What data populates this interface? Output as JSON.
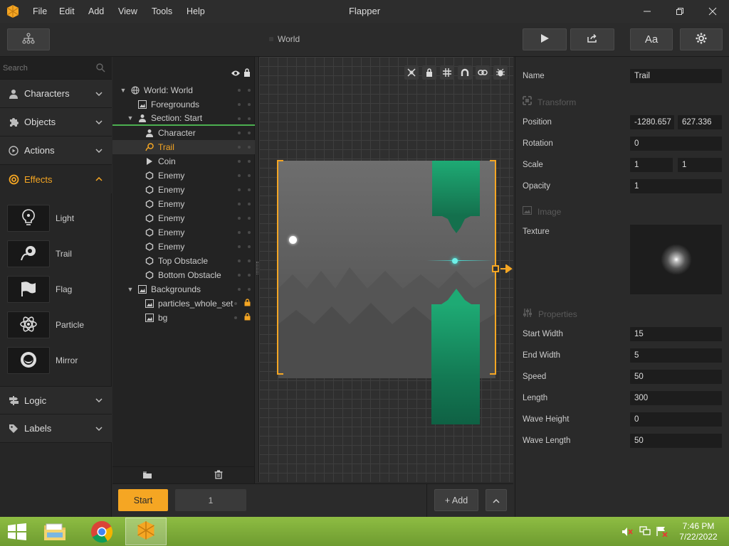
{
  "app": {
    "title": "Flapper"
  },
  "menu": [
    "File",
    "Edit",
    "Add",
    "View",
    "Tools",
    "Help"
  ],
  "toolbar": {
    "scene_name": "World",
    "font_button": "Aa"
  },
  "search": {
    "placeholder": "Search"
  },
  "categories": [
    {
      "label": "Characters"
    },
    {
      "label": "Objects"
    },
    {
      "label": "Actions"
    },
    {
      "label": "Effects"
    },
    {
      "label": "Logic"
    },
    {
      "label": "Labels"
    }
  ],
  "effects": [
    {
      "label": "Light",
      "icon": "light-bulb-icon"
    },
    {
      "label": "Trail",
      "icon": "trail-icon"
    },
    {
      "label": "Flag",
      "icon": "flag-icon"
    },
    {
      "label": "Particle",
      "icon": "atom-icon"
    },
    {
      "label": "Mirror",
      "icon": "mirror-icon"
    }
  ],
  "hierarchy": [
    {
      "label": "World: World",
      "icon": "globe-icon"
    },
    {
      "label": "Foregrounds",
      "icon": "image-icon"
    },
    {
      "label": "Section: Start",
      "icon": "user-icon"
    },
    {
      "label": "Character",
      "icon": "user-icon"
    },
    {
      "label": "Trail",
      "icon": "trail-icon"
    },
    {
      "label": "Coin",
      "icon": "play-icon"
    },
    {
      "label": "Enemy",
      "icon": "hexagon-icon"
    },
    {
      "label": "Enemy",
      "icon": "hexagon-icon"
    },
    {
      "label": "Enemy",
      "icon": "hexagon-icon"
    },
    {
      "label": "Enemy",
      "icon": "hexagon-icon"
    },
    {
      "label": "Enemy",
      "icon": "hexagon-icon"
    },
    {
      "label": "Enemy",
      "icon": "hexagon-icon"
    },
    {
      "label": "Top Obstacle",
      "icon": "hexagon-icon"
    },
    {
      "label": "Bottom Obstacle",
      "icon": "hexagon-icon"
    },
    {
      "label": "Backgrounds",
      "icon": "image-icon"
    },
    {
      "label": "particles_whole_set",
      "icon": "image-icon",
      "locked": true
    },
    {
      "label": "bg",
      "icon": "image-icon",
      "locked": true
    }
  ],
  "bottombar": {
    "section_button": "Start",
    "section_index": "1",
    "add_button": "+ Add"
  },
  "properties": {
    "name_label": "Name",
    "name_value": "Trail",
    "transform_header": "Transform",
    "position_label": "Position",
    "position_x": "-1280.657",
    "position_y": "627.336",
    "rotation_label": "Rotation",
    "rotation_value": "0",
    "scale_label": "Scale",
    "scale_x": "1",
    "scale_y": "1",
    "opacity_label": "Opacity",
    "opacity_value": "1",
    "image_header": "Image",
    "texture_label": "Texture",
    "properties_header": "Properties",
    "start_width_label": "Start Width",
    "start_width_value": "15",
    "end_width_label": "End Width",
    "end_width_value": "5",
    "speed_label": "Speed",
    "speed_value": "50",
    "length_label": "Length",
    "length_value": "300",
    "wave_height_label": "Wave Height",
    "wave_height_value": "0",
    "wave_length_label": "Wave Length",
    "wave_length_value": "50"
  },
  "taskbar": {
    "time": "7:46 PM",
    "date": "7/22/2022"
  },
  "colors": {
    "accent": "#f5a623",
    "obstacle": "#1a9e6e",
    "selection_line": "#4caf50"
  }
}
